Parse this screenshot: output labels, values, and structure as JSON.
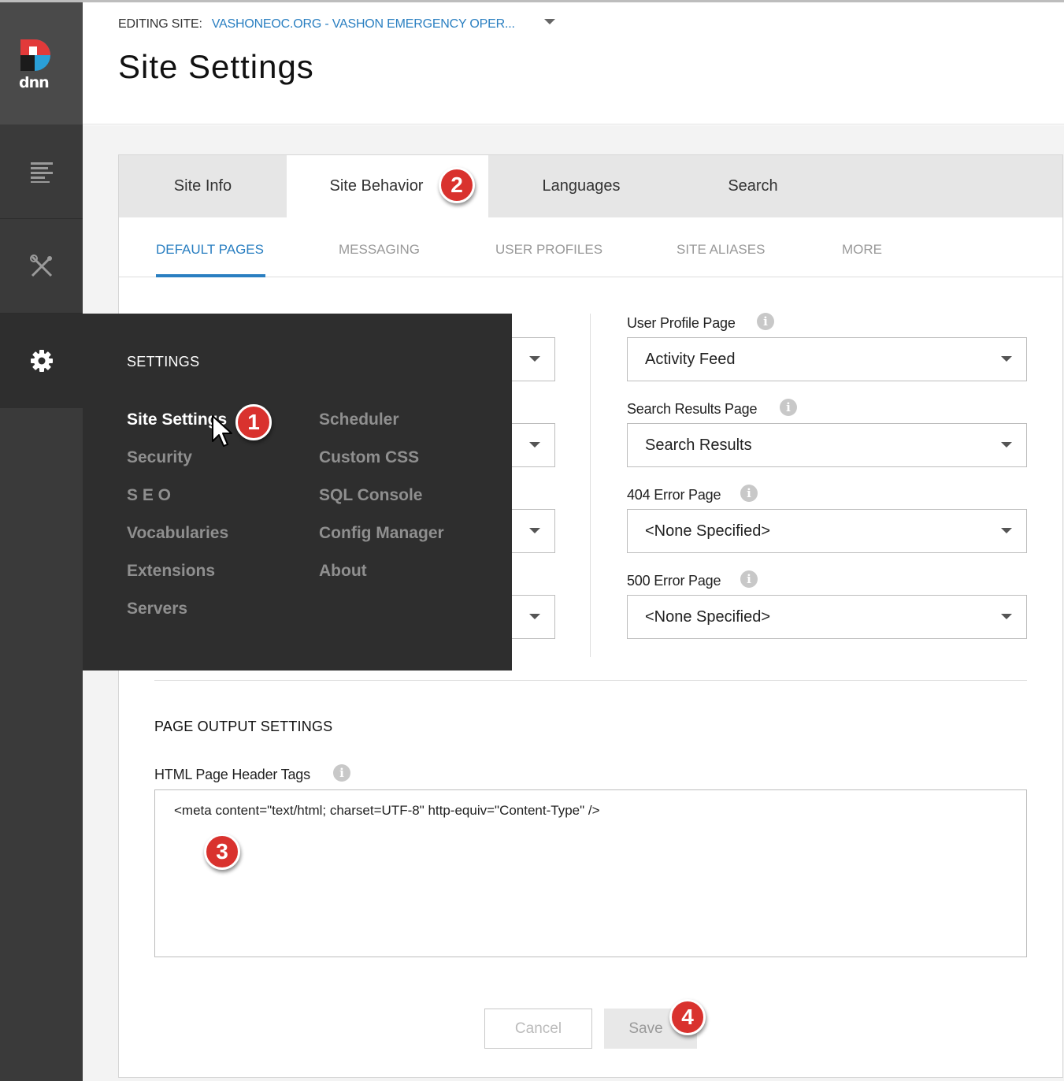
{
  "brand": {
    "logo_text": "DNN",
    "wordmark": "dnn"
  },
  "sidebar": {
    "icons": [
      "content-icon",
      "tools-icon",
      "settings-icon"
    ]
  },
  "header": {
    "editing_label": "EDITING SITE:",
    "site_name": "VASHONEOC.ORG - VASHON EMERGENCY OPER...",
    "title": "Site Settings"
  },
  "tabs": [
    {
      "label": "Site Info"
    },
    {
      "label": "Site Behavior"
    },
    {
      "label": "Languages"
    },
    {
      "label": "Search"
    }
  ],
  "subtabs": [
    {
      "label": "DEFAULT PAGES"
    },
    {
      "label": "MESSAGING"
    },
    {
      "label": "USER PROFILES"
    },
    {
      "label": "SITE ALIASES"
    },
    {
      "label": "MORE"
    }
  ],
  "fields": [
    {
      "label": "User Profile Page",
      "value": "Activity Feed"
    },
    {
      "label": "Search Results Page",
      "value": "Search Results"
    },
    {
      "label": "404 Error Page",
      "value": "<None Specified>"
    },
    {
      "label": "500 Error Page",
      "value": "<None Specified>"
    }
  ],
  "page_output": {
    "section_title": "PAGE OUTPUT SETTINGS",
    "header_tags_label": "HTML Page Header Tags",
    "header_tags_value": "<meta content=\"text/html; charset=UTF-8\" http-equiv=\"Content-Type\" />"
  },
  "actions": {
    "cancel": "Cancel",
    "save": "Save"
  },
  "flyout": {
    "title": "SETTINGS",
    "items_left": [
      "Site Settings",
      "Security",
      "S E O",
      "Vocabularies",
      "Extensions",
      "Servers"
    ],
    "items_right": [
      "Scheduler",
      "Custom CSS",
      "SQL Console",
      "Config Manager",
      "About"
    ]
  },
  "callouts": [
    "1",
    "2",
    "3",
    "4"
  ],
  "colors": {
    "accent": "#2a7fc1",
    "sidebar": "#3a3a3a",
    "flyout": "#2e2e2e",
    "callout": "#d9322e"
  },
  "info_icon_glyph": "i"
}
